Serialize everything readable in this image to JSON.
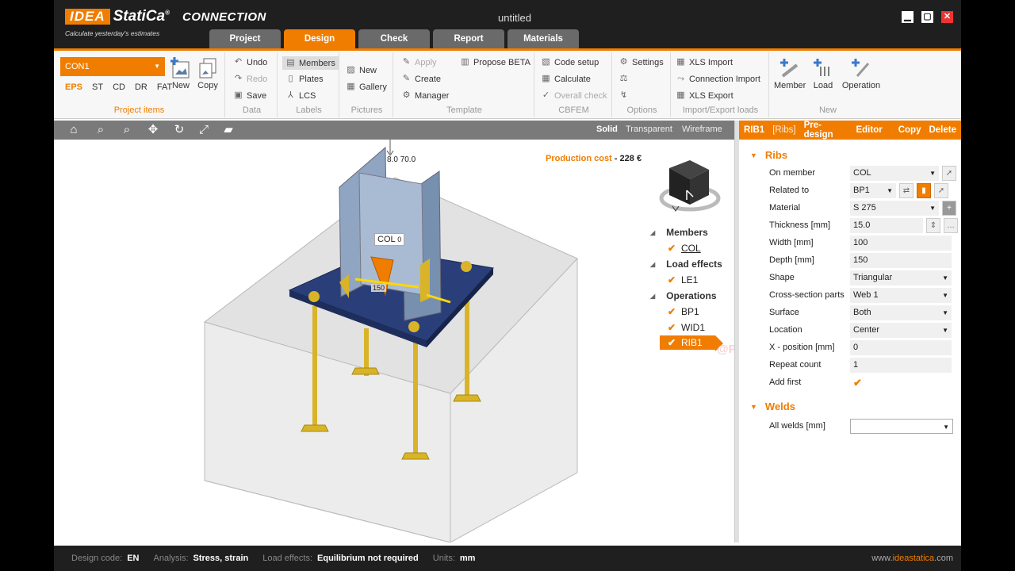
{
  "app": {
    "logo_idea": "IDEA",
    "logo_statica": "StatiCa",
    "logo_reg": "®",
    "product": "CONNECTION",
    "tagline": "Calculate yesterday's estimates",
    "window_title": "untitled"
  },
  "tabs": [
    {
      "label": "Project",
      "active": false
    },
    {
      "label": "Design",
      "active": true
    },
    {
      "label": "Check",
      "active": false
    },
    {
      "label": "Report",
      "active": false
    },
    {
      "label": "Materials",
      "active": false
    }
  ],
  "ribbon": {
    "project_items": {
      "connection": "CON1",
      "load_types": [
        "EPS",
        "ST",
        "CD",
        "DR",
        "FAT"
      ],
      "new": "New",
      "copy": "Copy",
      "label": "Project items"
    },
    "data": {
      "undo": "Undo",
      "redo": "Redo",
      "save": "Save",
      "label": "Data"
    },
    "labels": {
      "members": "Members",
      "plates": "Plates",
      "lcs": "LCS",
      "label": "Labels"
    },
    "pictures": {
      "new": "New",
      "gallery": "Gallery",
      "label": "Pictures"
    },
    "template": {
      "apply": "Apply",
      "create": "Create",
      "manager": "Manager",
      "propose": "Propose BETA",
      "label": "Template"
    },
    "cbfem": {
      "code_setup": "Code setup",
      "calculate": "Calculate",
      "overall_check": "Overall check",
      "label": "CBFEM"
    },
    "options": {
      "settings": "Settings",
      "label": "Options"
    },
    "import_export": {
      "xls_import": "XLS Import",
      "connection_import": "Connection Import",
      "xls_export": "XLS Export",
      "label": "Import/Export loads"
    },
    "new_group": {
      "member": "Member",
      "load": "Load",
      "operation": "Operation",
      "label": "New"
    }
  },
  "viewport": {
    "modes": [
      "Solid",
      "Transparent",
      "Wireframe"
    ],
    "active_mode": "Solid",
    "production_cost_label": "Production cost",
    "production_cost_sep": "-",
    "production_cost_value": "228 €",
    "labels": {
      "col": "COL",
      "dim1": "8.0",
      "dim2": "70.0",
      "dim3": "150",
      "dim4": "0"
    },
    "tree": {
      "members_label": "Members",
      "members": [
        "COL"
      ],
      "load_effects_label": "Load effects",
      "load_effects": [
        "LE1"
      ],
      "operations_label": "Operations",
      "operations": [
        "BP1",
        "WID1",
        "RIB1"
      ]
    },
    "watermark": "@PetsitPlusScript"
  },
  "panel": {
    "header": {
      "name": "RIB1",
      "type": "[Ribs]",
      "predesign": "Pre-design",
      "editor": "Editor",
      "copy": "Copy",
      "delete": "Delete"
    },
    "ribs_section": "Ribs",
    "rows": [
      {
        "label": "On member",
        "value": "COL"
      },
      {
        "label": "Related to",
        "value": "BP1"
      },
      {
        "label": "Material",
        "value": "S 275"
      },
      {
        "label": "Thickness [mm]",
        "value": "15.0"
      },
      {
        "label": "Width [mm]",
        "value": "100"
      },
      {
        "label": "Depth [mm]",
        "value": "150"
      },
      {
        "label": "Shape",
        "value": "Triangular"
      },
      {
        "label": "Cross-section parts",
        "value": "Web 1"
      },
      {
        "label": "Surface",
        "value": "Both"
      },
      {
        "label": "Location",
        "value": "Center"
      },
      {
        "label": "X - position [mm]",
        "value": "0"
      },
      {
        "label": "Repeat count",
        "value": "1"
      },
      {
        "label": "Add first",
        "value": "✔"
      }
    ],
    "welds_section": "Welds",
    "welds_row": {
      "label": "All welds [mm]",
      "value": ""
    }
  },
  "status": {
    "design_code_label": "Design code:",
    "design_code": "EN",
    "analysis_label": "Analysis:",
    "analysis": "Stress, strain",
    "load_effects_label": "Load effects:",
    "load_effects": "Equilibrium not required",
    "units_label": "Units:",
    "units": "mm",
    "site_prefix": "www.",
    "site_brand": "ideastatica",
    "site_suffix": ".com"
  },
  "colors": {
    "accent": "#f07d00",
    "plate": "#2a3f7a",
    "anchor": "#d9b428",
    "column": "#8fa5c2"
  }
}
